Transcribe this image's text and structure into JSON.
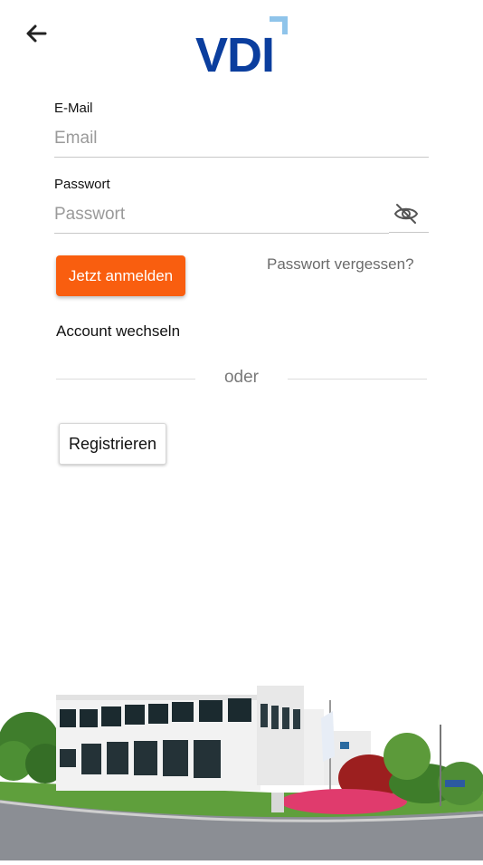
{
  "logo": {
    "text": "VDI",
    "colors": {
      "text": "#0b3e9e",
      "corner": "#8fc4ea"
    }
  },
  "form": {
    "email_label": "E-Mail",
    "email_placeholder": "Email",
    "email_value": "",
    "password_label": "Passwort",
    "password_placeholder": "Passwort",
    "password_value": ""
  },
  "actions": {
    "login_label": "Jetzt anmelden",
    "forgot_label": "Passwort vergessen?",
    "switch_account_label": "Account wechseln",
    "divider_label": "oder",
    "register_label": "Registrieren"
  },
  "icons": {
    "back": "arrow-left-icon",
    "password_toggle": "eye-off-icon"
  },
  "colors": {
    "accent": "#f95e0f",
    "link": "#6b6b6b"
  }
}
